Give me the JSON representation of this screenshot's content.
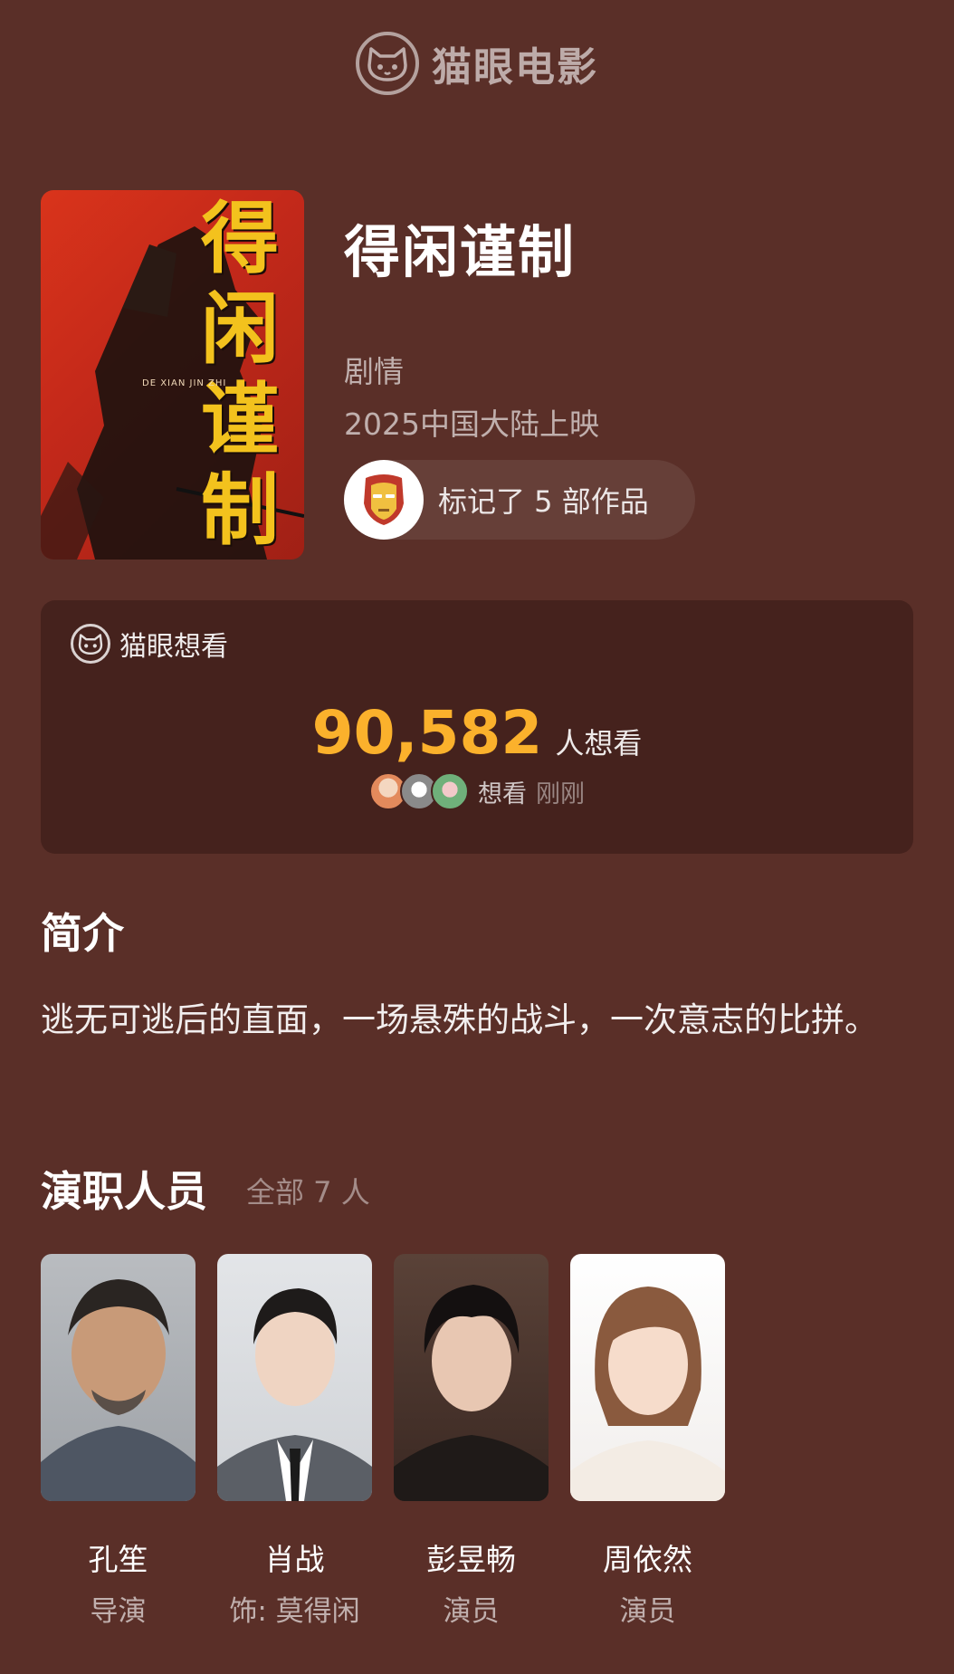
{
  "header": {
    "brand_name": "猫眼电影",
    "brand_icon": "cat-face-icon"
  },
  "movie": {
    "poster_title": "得闲谨制",
    "poster_subtitle": "DE XIAN JIN ZHI",
    "title": "得闲谨制",
    "genre": "剧情",
    "release": "2025中国大陆上映",
    "marked_text": "标记了 5 部作品",
    "marked_avatar_icon": "iron-man-mask-icon"
  },
  "want_to_see": {
    "label": "猫眼想看",
    "count": "90,582",
    "unit": "人想看",
    "recent_text": "想看",
    "recent_time": "刚刚",
    "accent_color": "#fbb12c"
  },
  "synopsis": {
    "title": "简介",
    "text": "逃无可逃后的直面，一场悬殊的战斗，一次意志的比拼。"
  },
  "cast": {
    "title": "演职人员",
    "count_text": "全部 7 人",
    "members": [
      {
        "name": "孔笙",
        "role": "导演"
      },
      {
        "name": "肖战",
        "role": "饰: 莫得闲"
      },
      {
        "name": "彭昱畅",
        "role": "演员"
      },
      {
        "name": "周依然",
        "role": "演员"
      }
    ]
  },
  "colors": {
    "background": "#5a2f28",
    "card": "#45221d"
  }
}
